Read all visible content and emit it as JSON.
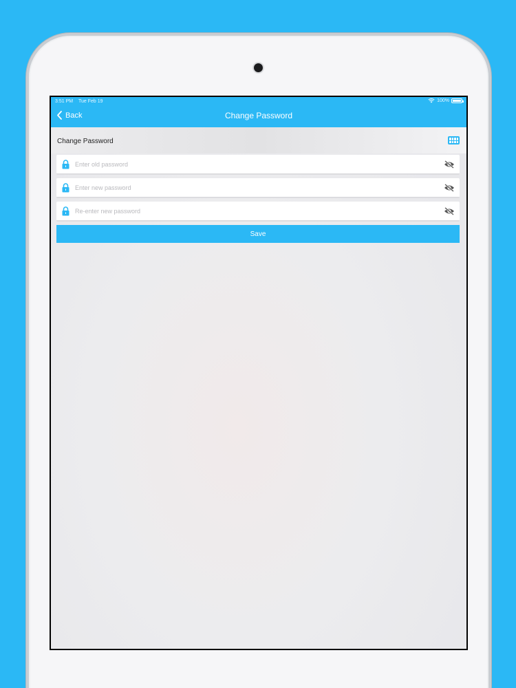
{
  "status_bar": {
    "time": "3:51 PM",
    "date": "Tue Feb 19",
    "battery": "100%"
  },
  "nav": {
    "back_label": "Back",
    "title": "Change Password"
  },
  "section": {
    "title": "Change Password",
    "keyboard_icon": "keyboard-icon"
  },
  "fields": [
    {
      "placeholder": "Enter old password",
      "value": "",
      "icon": "lock-icon",
      "toggle_icon": "eye-slash-icon"
    },
    {
      "placeholder": "Enter new password",
      "value": "",
      "icon": "lock-icon",
      "toggle_icon": "eye-slash-icon"
    },
    {
      "placeholder": "Re-enter new password",
      "value": "",
      "icon": "lock-icon",
      "toggle_icon": "eye-slash-icon"
    }
  ],
  "save_label": "Save",
  "colors": {
    "accent": "#2bb8f5",
    "background": "#2bb8f5",
    "field_bg": "#ffffff"
  }
}
